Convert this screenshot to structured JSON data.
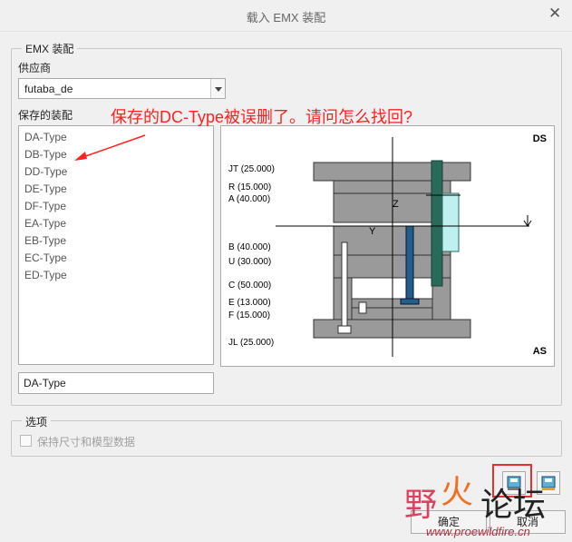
{
  "window": {
    "title": "载入 EMX 装配"
  },
  "group_main": {
    "legend": "EMX  装配",
    "supplier_label": "供应商",
    "supplier_value": "futaba_de",
    "saved_label": "保存的装配",
    "saved_items": [
      "DA-Type",
      "DB-Type",
      "DD-Type",
      "DE-Type",
      "DF-Type",
      "EA-Type",
      "EB-Type",
      "EC-Type",
      "ED-Type"
    ],
    "selected_name": "DA-Type"
  },
  "preview": {
    "top_right": "DS",
    "bottom_right": "AS",
    "axis_z": "Z",
    "axis_y": "Y",
    "dims": [
      "JT (25.000)",
      "R (15.000)",
      "A (40.000)",
      "B (40.000)",
      "U (30.000)",
      "C (50.000)",
      "E (13.000)",
      "F (15.000)",
      "JL (25.000)"
    ]
  },
  "options": {
    "legend": "选项",
    "keep_dims_label": "保持尺寸和模型数据"
  },
  "buttons": {
    "ok": "确定",
    "cancel": "取消"
  },
  "annotation": {
    "text": "保存的DC-Type被误删了。请问怎么找回?"
  },
  "watermark": {
    "chinese_a": "野",
    "chinese_b": "火",
    "chinese_c": "论坛",
    "url": "www.proewildfire.cn"
  },
  "colors": {
    "annotation_red": "#ff2020",
    "plate_gray": "#9a9a9a",
    "pin_blue": "#1f5f8a",
    "teal": "#2a6a5a"
  }
}
